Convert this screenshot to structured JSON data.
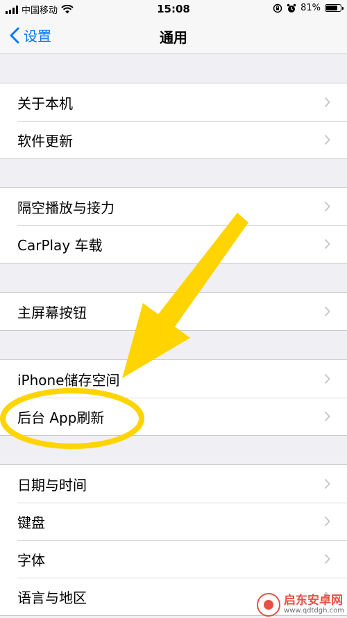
{
  "status_bar": {
    "carrier": "中国移动",
    "time": "15:08",
    "battery_percent": "81%",
    "battery_level": 0.81
  },
  "nav": {
    "back_label": "设置",
    "title": "通用"
  },
  "groups": [
    {
      "items": [
        {
          "label": "关于本机"
        },
        {
          "label": "软件更新"
        }
      ]
    },
    {
      "items": [
        {
          "label": "隔空播放与接力"
        },
        {
          "label": "CarPlay 车载"
        }
      ]
    },
    {
      "items": [
        {
          "label": "主屏幕按钮"
        }
      ]
    },
    {
      "items": [
        {
          "label": "iPhone储存空间"
        },
        {
          "label": "后台 App刷新"
        }
      ]
    },
    {
      "items": [
        {
          "label": "日期与时间"
        },
        {
          "label": "键盘"
        },
        {
          "label": "字体"
        },
        {
          "label": "语言与地区"
        }
      ]
    }
  ],
  "annotation": {
    "color": "#ffd400",
    "highlighted_item": "后台 App刷新"
  },
  "watermark": {
    "title": "启东安卓网",
    "url": "www.qdtdgh.com"
  },
  "colors": {
    "accent": "#007aff",
    "background": "#efeff4",
    "chevron": "#c7c7cc"
  }
}
